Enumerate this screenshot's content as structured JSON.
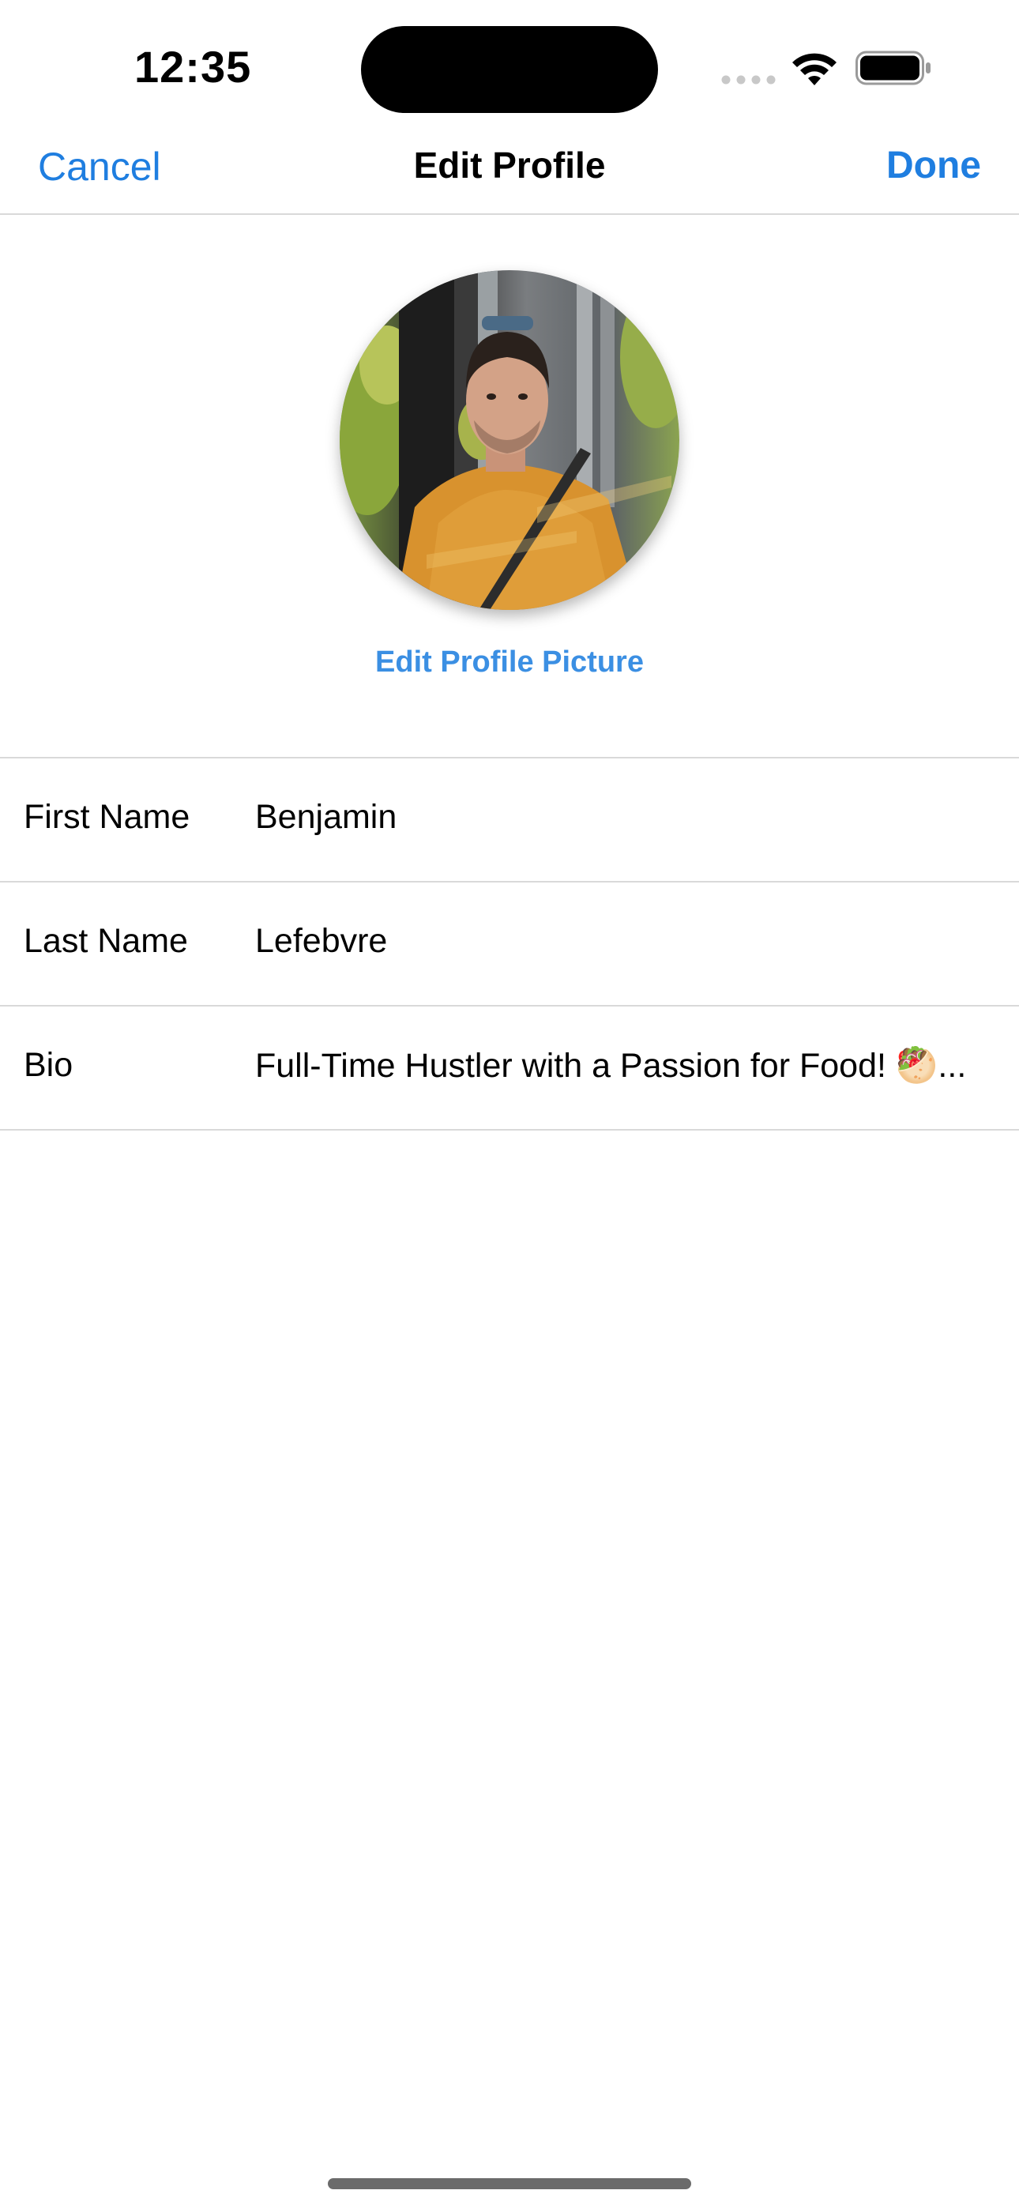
{
  "status_bar": {
    "time": "12:35",
    "icons": [
      "cellular-dots-icon",
      "wifi-icon",
      "battery-icon"
    ]
  },
  "nav": {
    "cancel_label": "Cancel",
    "title": "Edit Profile",
    "done_label": "Done"
  },
  "profile": {
    "avatar": "profile-photo",
    "edit_picture_label": "Edit Profile Picture"
  },
  "form": {
    "rows": [
      {
        "label": "First Name",
        "value": "Benjamin"
      },
      {
        "label": "Last Name",
        "value": "Lefebvre"
      },
      {
        "label": "Bio",
        "value": "Full-Time Hustler with a Passion for Food! 🥙..."
      }
    ]
  },
  "colors": {
    "accent": "#1f7ee0",
    "link": "#3b8fe3",
    "separator": "#d9d9d9",
    "background": "#ffffff"
  }
}
